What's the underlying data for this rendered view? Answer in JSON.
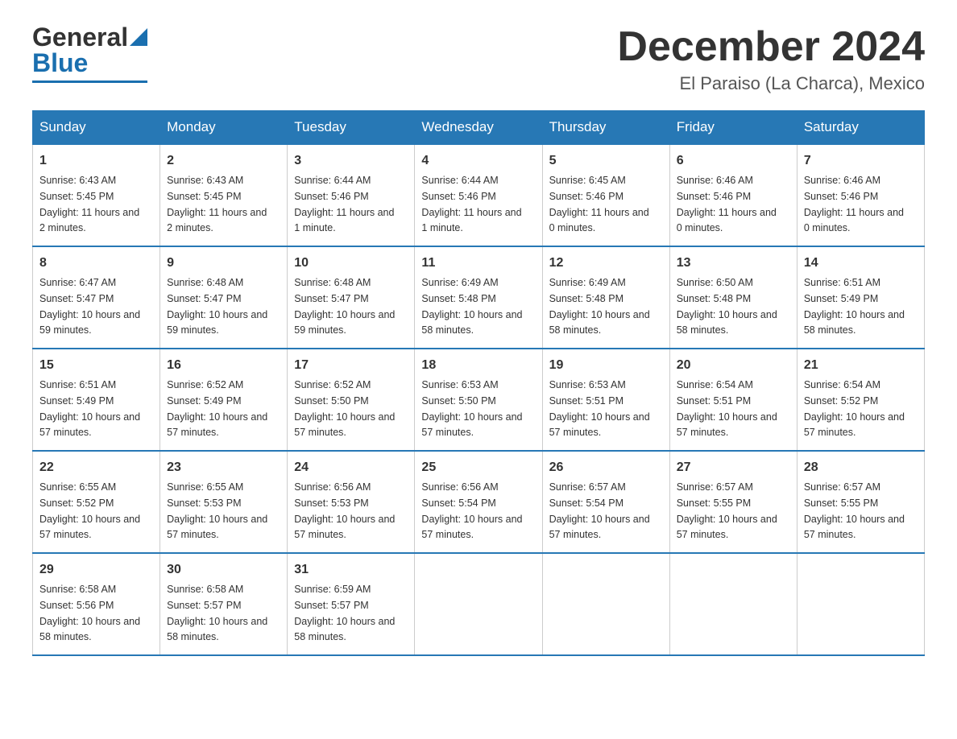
{
  "header": {
    "logo_general": "General",
    "logo_blue": "Blue",
    "month_title": "December 2024",
    "location": "El Paraiso (La Charca), Mexico"
  },
  "days_of_week": [
    "Sunday",
    "Monday",
    "Tuesday",
    "Wednesday",
    "Thursday",
    "Friday",
    "Saturday"
  ],
  "weeks": [
    [
      {
        "day": "1",
        "sunrise": "6:43 AM",
        "sunset": "5:45 PM",
        "daylight": "11 hours and 2 minutes."
      },
      {
        "day": "2",
        "sunrise": "6:43 AM",
        "sunset": "5:45 PM",
        "daylight": "11 hours and 2 minutes."
      },
      {
        "day": "3",
        "sunrise": "6:44 AM",
        "sunset": "5:46 PM",
        "daylight": "11 hours and 1 minute."
      },
      {
        "day": "4",
        "sunrise": "6:44 AM",
        "sunset": "5:46 PM",
        "daylight": "11 hours and 1 minute."
      },
      {
        "day": "5",
        "sunrise": "6:45 AM",
        "sunset": "5:46 PM",
        "daylight": "11 hours and 0 minutes."
      },
      {
        "day": "6",
        "sunrise": "6:46 AM",
        "sunset": "5:46 PM",
        "daylight": "11 hours and 0 minutes."
      },
      {
        "day": "7",
        "sunrise": "6:46 AM",
        "sunset": "5:46 PM",
        "daylight": "11 hours and 0 minutes."
      }
    ],
    [
      {
        "day": "8",
        "sunrise": "6:47 AM",
        "sunset": "5:47 PM",
        "daylight": "10 hours and 59 minutes."
      },
      {
        "day": "9",
        "sunrise": "6:48 AM",
        "sunset": "5:47 PM",
        "daylight": "10 hours and 59 minutes."
      },
      {
        "day": "10",
        "sunrise": "6:48 AM",
        "sunset": "5:47 PM",
        "daylight": "10 hours and 59 minutes."
      },
      {
        "day": "11",
        "sunrise": "6:49 AM",
        "sunset": "5:48 PM",
        "daylight": "10 hours and 58 minutes."
      },
      {
        "day": "12",
        "sunrise": "6:49 AM",
        "sunset": "5:48 PM",
        "daylight": "10 hours and 58 minutes."
      },
      {
        "day": "13",
        "sunrise": "6:50 AM",
        "sunset": "5:48 PM",
        "daylight": "10 hours and 58 minutes."
      },
      {
        "day": "14",
        "sunrise": "6:51 AM",
        "sunset": "5:49 PM",
        "daylight": "10 hours and 58 minutes."
      }
    ],
    [
      {
        "day": "15",
        "sunrise": "6:51 AM",
        "sunset": "5:49 PM",
        "daylight": "10 hours and 57 minutes."
      },
      {
        "day": "16",
        "sunrise": "6:52 AM",
        "sunset": "5:49 PM",
        "daylight": "10 hours and 57 minutes."
      },
      {
        "day": "17",
        "sunrise": "6:52 AM",
        "sunset": "5:50 PM",
        "daylight": "10 hours and 57 minutes."
      },
      {
        "day": "18",
        "sunrise": "6:53 AM",
        "sunset": "5:50 PM",
        "daylight": "10 hours and 57 minutes."
      },
      {
        "day": "19",
        "sunrise": "6:53 AM",
        "sunset": "5:51 PM",
        "daylight": "10 hours and 57 minutes."
      },
      {
        "day": "20",
        "sunrise": "6:54 AM",
        "sunset": "5:51 PM",
        "daylight": "10 hours and 57 minutes."
      },
      {
        "day": "21",
        "sunrise": "6:54 AM",
        "sunset": "5:52 PM",
        "daylight": "10 hours and 57 minutes."
      }
    ],
    [
      {
        "day": "22",
        "sunrise": "6:55 AM",
        "sunset": "5:52 PM",
        "daylight": "10 hours and 57 minutes."
      },
      {
        "day": "23",
        "sunrise": "6:55 AM",
        "sunset": "5:53 PM",
        "daylight": "10 hours and 57 minutes."
      },
      {
        "day": "24",
        "sunrise": "6:56 AM",
        "sunset": "5:53 PM",
        "daylight": "10 hours and 57 minutes."
      },
      {
        "day": "25",
        "sunrise": "6:56 AM",
        "sunset": "5:54 PM",
        "daylight": "10 hours and 57 minutes."
      },
      {
        "day": "26",
        "sunrise": "6:57 AM",
        "sunset": "5:54 PM",
        "daylight": "10 hours and 57 minutes."
      },
      {
        "day": "27",
        "sunrise": "6:57 AM",
        "sunset": "5:55 PM",
        "daylight": "10 hours and 57 minutes."
      },
      {
        "day": "28",
        "sunrise": "6:57 AM",
        "sunset": "5:55 PM",
        "daylight": "10 hours and 57 minutes."
      }
    ],
    [
      {
        "day": "29",
        "sunrise": "6:58 AM",
        "sunset": "5:56 PM",
        "daylight": "10 hours and 58 minutes."
      },
      {
        "day": "30",
        "sunrise": "6:58 AM",
        "sunset": "5:57 PM",
        "daylight": "10 hours and 58 minutes."
      },
      {
        "day": "31",
        "sunrise": "6:59 AM",
        "sunset": "5:57 PM",
        "daylight": "10 hours and 58 minutes."
      },
      null,
      null,
      null,
      null
    ]
  ],
  "labels": {
    "sunrise": "Sunrise:",
    "sunset": "Sunset:",
    "daylight": "Daylight:"
  }
}
